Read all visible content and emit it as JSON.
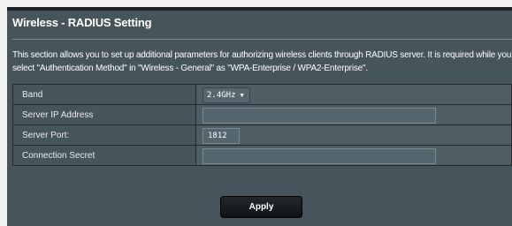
{
  "page": {
    "title": "Wireless - RADIUS Setting",
    "description": "This section allows you to set up additional parameters for authorizing wireless clients through RADIUS server. It is required while you select \"Authentication Method\" in \"Wireless - General\" as \"WPA-Enterprise / WPA2-Enterprise\"."
  },
  "form": {
    "band": {
      "label": "Band",
      "value": "2.4GHz"
    },
    "server_ip": {
      "label": "Server IP Address",
      "value": ""
    },
    "server_port": {
      "label": "Server Port:",
      "value": "1812"
    },
    "connection_secret": {
      "label": "Connection Secret",
      "value": ""
    }
  },
  "actions": {
    "apply_label": "Apply"
  }
}
